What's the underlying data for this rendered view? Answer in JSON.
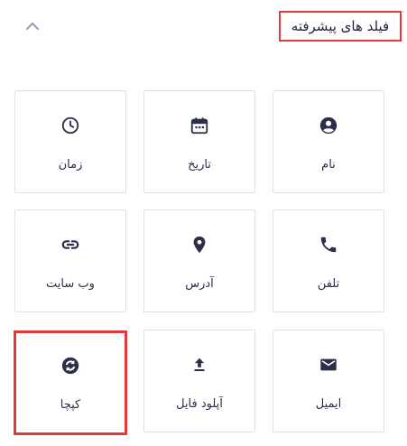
{
  "header": {
    "title": "فیلد های پیشرفته"
  },
  "tiles": [
    {
      "label": "زمان",
      "icon": "clock-icon"
    },
    {
      "label": "تاریخ",
      "icon": "calendar-icon"
    },
    {
      "label": "نام",
      "icon": "person-circle-icon"
    },
    {
      "label": "وب سایت",
      "icon": "link-icon"
    },
    {
      "label": "آدرس",
      "icon": "map-pin-icon"
    },
    {
      "label": "تلفن",
      "icon": "phone-icon"
    },
    {
      "label": "کپچا",
      "icon": "refresh-captcha-icon"
    },
    {
      "label": "آپلود فایل",
      "icon": "upload-icon"
    },
    {
      "label": "ایمیل",
      "icon": "mail-icon"
    }
  ],
  "colors": {
    "highlight": "#e03a3a",
    "icon": "#2b2f4a",
    "border": "#dfe1ea"
  }
}
